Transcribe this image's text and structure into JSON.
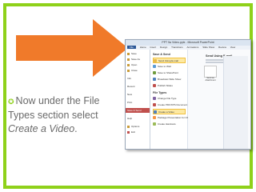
{
  "slide": {
    "bullet_text_1": "Now under the File Types section select ",
    "bullet_text_em": "Create a Video",
    "bullet_text_2": ".",
    "accent_color": "#8fd11a",
    "arrow_color": "#f07a2a"
  },
  "window": {
    "title": "PPT 5a Video.pptx - Microsoft PowerPoint",
    "menu": [
      "File",
      "Home",
      "Insert",
      "Design",
      "Transitions",
      "Animations",
      "Slide Show",
      "Review",
      "View"
    ],
    "nav": [
      "Save",
      "Save As",
      "Open",
      "Close",
      "Info",
      "Recent",
      "New",
      "Print",
      "Save & Send",
      "Help",
      "Options",
      "Exit"
    ],
    "nav_active": "Save & Send",
    "save_send_header": "Save & Send",
    "save_send_items": [
      "Send Using E-mail",
      "Save to Web",
      "Save to SharePoint",
      "Broadcast Slide Show",
      "Publish Slides"
    ],
    "file_types_header": "File Types",
    "file_types_items": [
      "Change File Type",
      "Create PDF/XPS Document",
      "Create a Video",
      "Package Presentation for CD",
      "Create Handouts"
    ],
    "file_types_selected": "Create a Video",
    "right_title": "Send Using E-mail",
    "right_box_label": "Send as Attachment"
  }
}
